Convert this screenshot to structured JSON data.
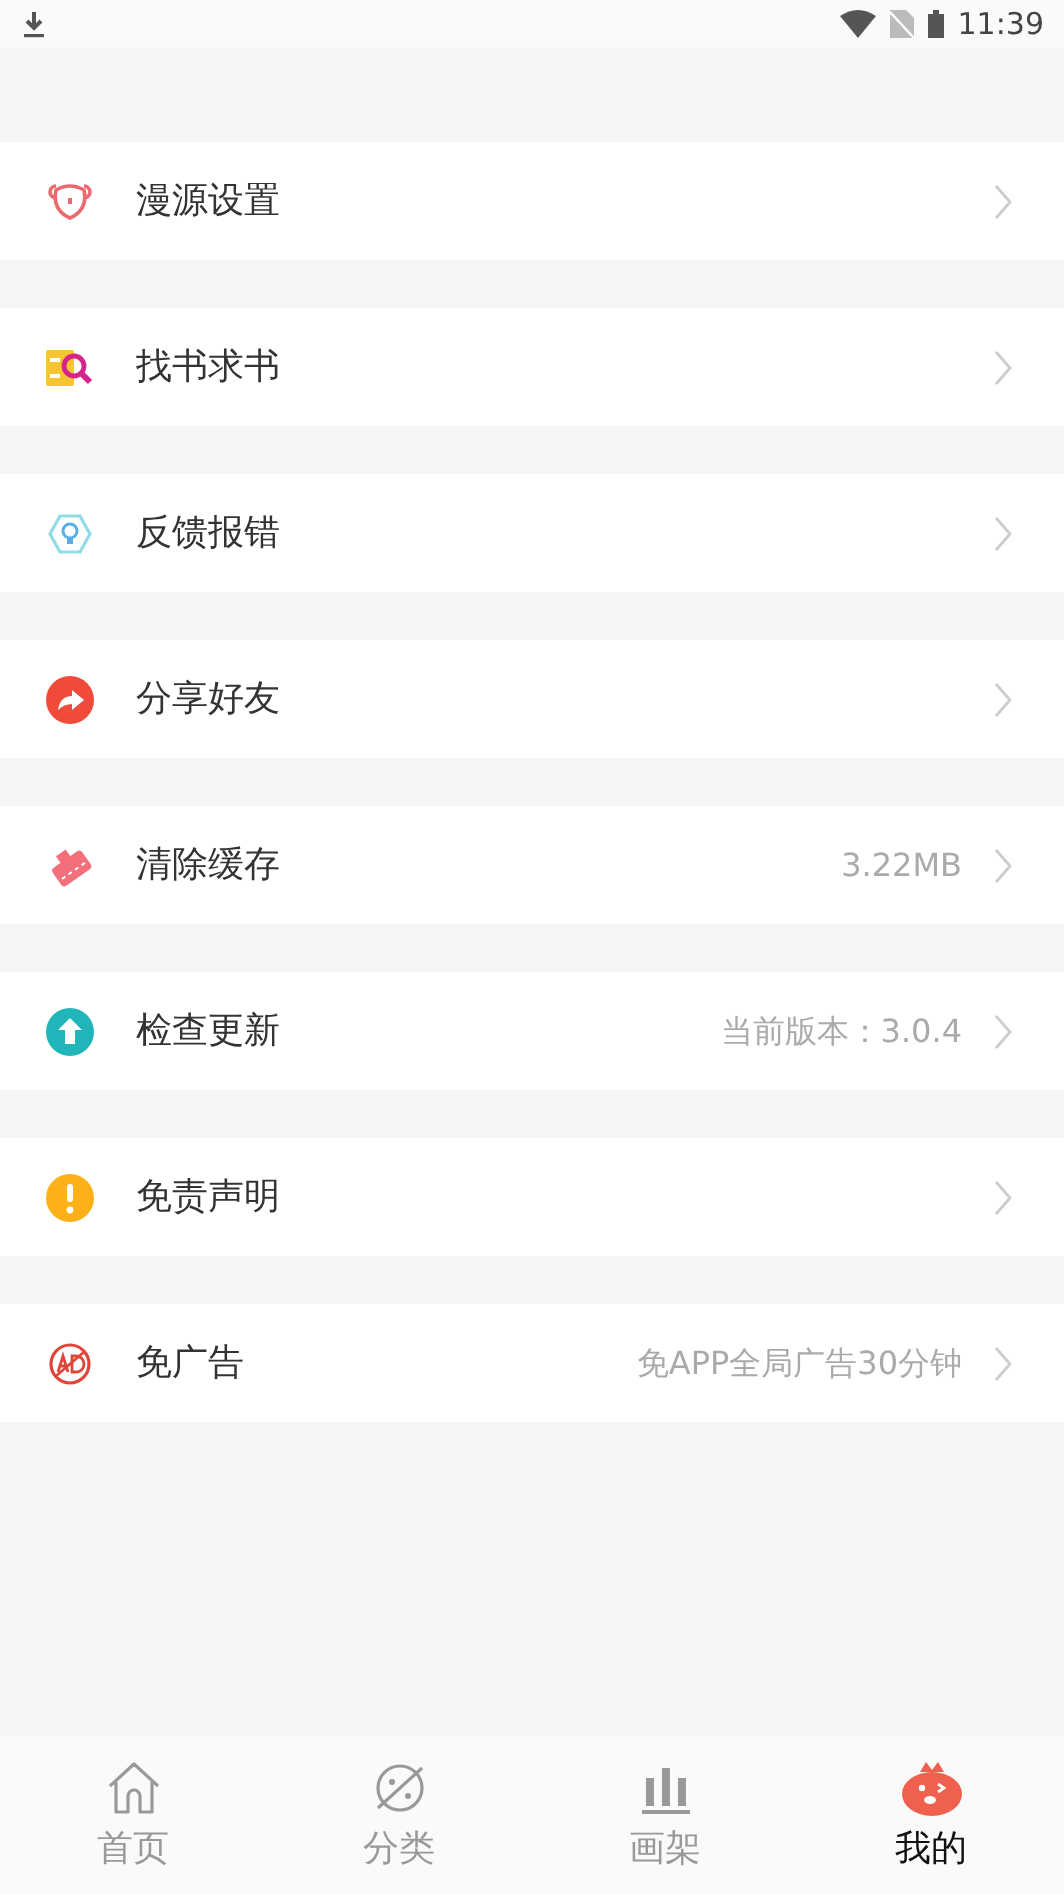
{
  "status_bar": {
    "time": "11:39"
  },
  "menu": [
    {
      "label": "漫源设置"
    },
    {
      "label": "找书求书"
    },
    {
      "label": "反馈报错"
    },
    {
      "label": "分享好友"
    },
    {
      "label": "清除缓存",
      "value": "3.22MB"
    },
    {
      "label": "检查更新",
      "value": "当前版本：3.0.4"
    },
    {
      "label": "免责声明"
    },
    {
      "label": "免广告",
      "value": "免APP全局广告30分钟"
    }
  ],
  "tabs": [
    {
      "label": "首页",
      "selected": false
    },
    {
      "label": "分类",
      "selected": false
    },
    {
      "label": "画架",
      "selected": false
    },
    {
      "label": "我的",
      "selected": true
    }
  ]
}
